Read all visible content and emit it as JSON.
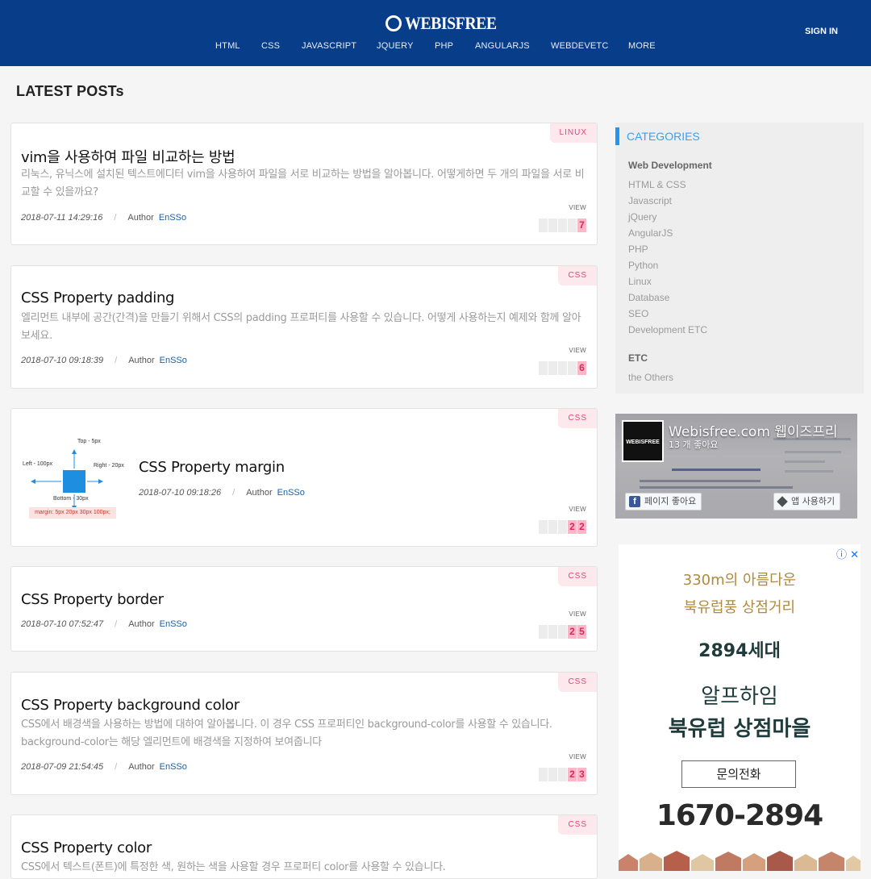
{
  "header": {
    "logo_text": "WEBISFREE",
    "nav": [
      "HTML",
      "CSS",
      "JAVASCRIPT",
      "JQUERY",
      "PHP",
      "ANGULARJS",
      "WEBDEVETC",
      "MORE"
    ],
    "signin_label": "SIGN IN"
  },
  "main": {
    "section_title": "LATEST POSTs",
    "posts": [
      {
        "category": "LINUX",
        "title": "vim을 사용하여 파일 비교하는 방법",
        "excerpt": "리눅스, 유닉스에 설치된 텍스트에디터 vim을 사용하여 파일을 서로 비교하는 방법을 알아봅니다. 어떻게하면 두 개의 파일을 서로 비교할 수 있을까요?",
        "date": "2018-07-11 14:29:16",
        "author_label": "Author",
        "author": "EnSSo",
        "view_label": "VIEW",
        "views": "7"
      },
      {
        "category": "CSS",
        "title": "CSS Property padding",
        "excerpt": "엘리먼트 내부에 공간(간격)을 만들기 위해서 CSS의 padding 프로퍼티를 사용할 수 있습니다. 어떻게 사용하는지 예제와 함께 알아보세요.",
        "date": "2018-07-10 09:18:39",
        "author_label": "Author",
        "author": "EnSSo",
        "view_label": "VIEW",
        "views": "6"
      },
      {
        "category": "CSS",
        "title": "CSS Property margin",
        "excerpt": "",
        "date": "2018-07-10 09:18:26",
        "author_label": "Author",
        "author": "EnSSo",
        "view_label": "VIEW",
        "views": "22",
        "thumbnail": {
          "top": "Top - 5px",
          "left": "Left - 100px",
          "right": "Right - 20px",
          "bottom": "Bottom - 30px",
          "code": "margin: 5px 20px 30px 100px;"
        }
      },
      {
        "category": "CSS",
        "title": "CSS Property border",
        "excerpt": "",
        "date": "2018-07-10 07:52:47",
        "author_label": "Author",
        "author": "EnSSo",
        "view_label": "VIEW",
        "views": "25"
      },
      {
        "category": "CSS",
        "title": "CSS Property background color",
        "excerpt": "CSS에서 배경색을 사용하는 방법에 대하여 알아봅니다. 이 경우 CSS 프로퍼티인 background-color를 사용할 수 있습니다. background-color는 해당 엘리먼트에 배경색을 지정하여 보여줍니다",
        "date": "2018-07-09 21:54:45",
        "author_label": "Author",
        "author": "EnSSo",
        "view_label": "VIEW",
        "views": "23"
      },
      {
        "category": "CSS",
        "title": "CSS Property color",
        "excerpt": "CSS에서 텍스트(폰트)에 특정한 색, 원하는 색을 사용할 경우 프로퍼티 color를 사용할 수 있습니다."
      }
    ]
  },
  "sidebar": {
    "categories_title": "CATEGORIES",
    "groups": [
      {
        "name": "Web Development",
        "items": [
          "HTML & CSS",
          "Javascript",
          "jQuery",
          "AngularJS",
          "PHP",
          "Python",
          "Linux",
          "Database",
          "SEO",
          "Development ETC"
        ]
      },
      {
        "name": "ETC",
        "items": [
          "the Others"
        ]
      }
    ],
    "facebook": {
      "page_name": "Webisfree.com 웹이즈프리",
      "likes": "13 개 좋아요",
      "avatar_text": "WEBISFREE",
      "like_button": "페이지 좋아요",
      "app_button": "앱 사용하기"
    },
    "ad": {
      "line1": "330m의 아름다운",
      "line2": "북유럽풍 상점거리",
      "line3": "2894세대",
      "line4": "알프하임",
      "line5": "북유럽 상점마을",
      "cta": "문의전화",
      "phone": "1670-2894"
    }
  },
  "colors": {
    "header_bg": "#083d8a",
    "accent_blue": "#2196f3",
    "badge_pink": "#e0457b",
    "view_counter": "#e0245e"
  }
}
